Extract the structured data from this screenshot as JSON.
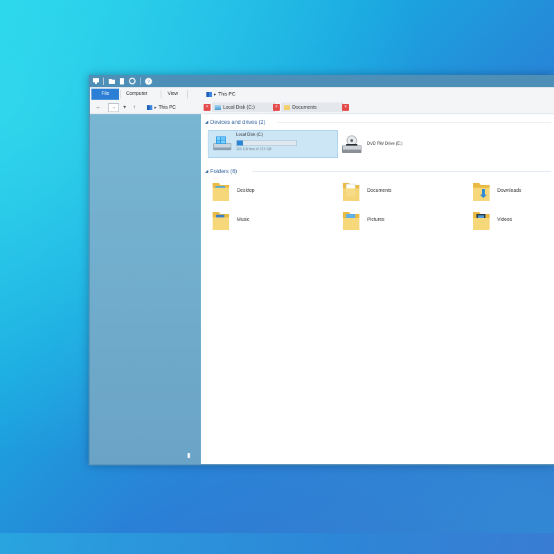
{
  "window": {
    "ribbon_tabs": {
      "file": "File",
      "computer": "Computer",
      "view": "View"
    },
    "top_breadcrumb": "This PC",
    "address_path": "This PC",
    "folder_tabs": [
      "Local Disk (C:)",
      "Documents"
    ]
  },
  "groups": {
    "devices_header": "Devices and drives (2)",
    "folders_header": "Folders (6)"
  },
  "drives": {
    "c": {
      "name": "Local Disk (C:)",
      "free_text": "201 GB free of 223 GB",
      "used_fraction": 0.1
    },
    "dvd": {
      "name": "DVD RW Drive (E:)"
    }
  },
  "folders": [
    "Desktop",
    "Documents",
    "Downloads",
    "Music",
    "Pictures",
    "Videos"
  ],
  "colors": {
    "accent": "#2b7fd4",
    "group_header": "#2c5e9c",
    "close_tab": "#e44a4a"
  }
}
